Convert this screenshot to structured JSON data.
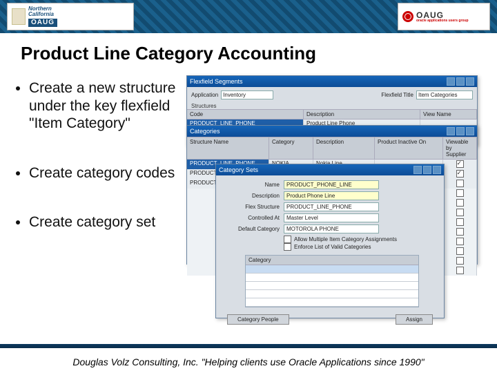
{
  "header": {
    "left_logo": {
      "line1": "Northern",
      "line2": "California",
      "badge": "OAUG"
    },
    "right_logo": {
      "big": "OAUG",
      "small": "oracle applications users group"
    }
  },
  "title": "Product Line Category Accounting",
  "bullets": [
    "Create a new structure under the key flexfield \"Item Category\"",
    "Create category codes",
    "Create category set"
  ],
  "win1": {
    "title": "Flexfield Segments",
    "application_label": "Application",
    "application_value": "Inventory",
    "flexfield_label": "Flexfield Title",
    "flexfield_value": "Item Categories",
    "section_label": "Structures",
    "cols": [
      "Code",
      "Description",
      "View Name"
    ],
    "rows": [
      {
        "code": "PRODUCT_LINE_PHONE",
        "desc": "Product Line Phone",
        "view": ""
      }
    ]
  },
  "win2": {
    "title": "Categories",
    "cols": [
      "Structure Name",
      "Category",
      "Description",
      "Product Inactive On",
      "Viewable by Supplier"
    ],
    "rows": [
      {
        "structure": "PRODUCT_LINE_PHONE",
        "category": "NOKIA",
        "description": "Nokia Line",
        "inactive": "",
        "view": true
      },
      {
        "structure": "PRODUCT_LINE_PHONE",
        "category": "",
        "description": "",
        "inactive": "",
        "view": true
      },
      {
        "structure": "PRODUCT_LINE_PHONE",
        "category": "",
        "description": "",
        "inactive": "",
        "view": false
      }
    ]
  },
  "win3": {
    "title": "Category Sets",
    "fields": {
      "name_label": "Name",
      "name_value": "PRODUCT_PHONE_LINE",
      "desc_label": "Description",
      "desc_value": "Product Phone Line",
      "flex_label": "Flex Structure",
      "flex_value": "PRODUCT_LINE_PHONE",
      "ctrl_label": "Controlled At",
      "ctrl_value": "Master Level",
      "def_label": "Default Category",
      "def_value": "MOTOROLA PHONE"
    },
    "check1": "Allow Multiple Item Category Assignments",
    "check2": "Enforce List of Valid Categories",
    "grid_header": "Category",
    "buttons": {
      "left": "Category People",
      "right": "Assign"
    }
  },
  "footer": "Douglas Volz Consulting, Inc. \"Helping clients use Oracle Applications since 1990\""
}
